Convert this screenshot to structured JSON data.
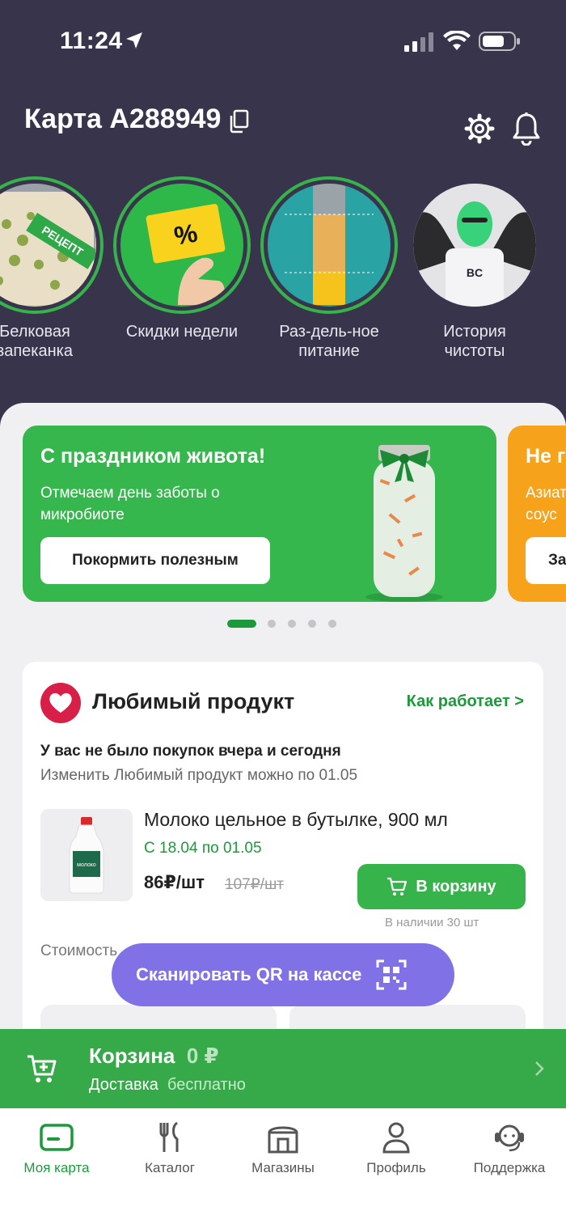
{
  "status_bar": {
    "time": "11:24"
  },
  "header": {
    "title": "Карта А288949"
  },
  "stories": [
    {
      "label": "Белковая\nзапеканка",
      "badge": "РЕЦЕПТ"
    },
    {
      "label": "Скидки недели"
    },
    {
      "label": "Раз-дель-ное\nпитание"
    },
    {
      "label": "История\nчистоты"
    }
  ],
  "banners": [
    {
      "title": "С праздником живота!",
      "text": "Отмечаем день заботы о микробиоте",
      "button": "Покормить полезным",
      "color": "#36b74d"
    },
    {
      "title": "Не г",
      "text": "Азиат\nсоус",
      "button": "За",
      "color": "#f7a21b"
    }
  ],
  "carousel": {
    "count": 5,
    "active": 0
  },
  "favorite": {
    "title": "Любимый продукт",
    "link": "Как работает >",
    "note": "У вас не было покупок вчера и сегодня",
    "sub": "Изменить Любимый продукт можно по 01.05",
    "product": {
      "name": "Молоко цельное в бутылке, 900 мл",
      "dates": "С 18.04 по 01.05",
      "price": "86₽/шт",
      "old_price": "107₽/шт",
      "button": "В корзину",
      "stock": "В наличии 30 шт"
    },
    "desc": "Стоимость ... ванного адреса и"
  },
  "qr_button": {
    "label": "Сканировать QR на кассе"
  },
  "cart": {
    "title": "Корзина",
    "sum": "0 ₽",
    "delivery": "Доставка",
    "delivery_value": "бесплатно"
  },
  "tabs": [
    {
      "label": "Моя карта",
      "active": true
    },
    {
      "label": "Каталог"
    },
    {
      "label": "Магазины"
    },
    {
      "label": "Профиль"
    },
    {
      "label": "Поддержка"
    }
  ],
  "colors": {
    "bg": "#37344c",
    "green": "#36b34a",
    "accent_green": "#1c9a3b",
    "purple": "#8072e6",
    "orange": "#f7a21b"
  }
}
